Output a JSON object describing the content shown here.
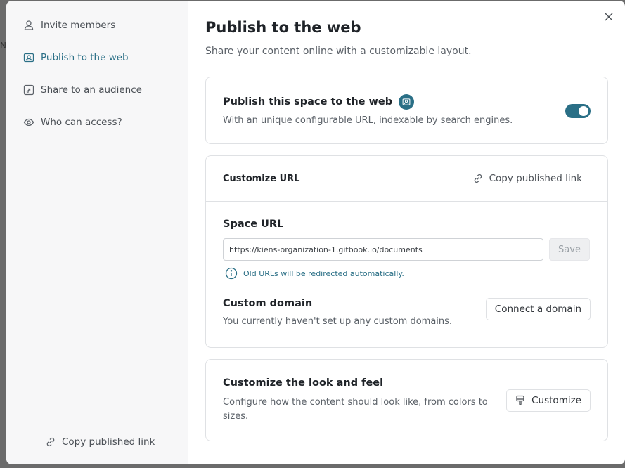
{
  "backdrop_letter": "N",
  "sidebar": {
    "items": [
      {
        "label": "Invite members",
        "icon": "user-icon",
        "active": false
      },
      {
        "label": "Publish to the web",
        "icon": "globe-card-icon",
        "active": true
      },
      {
        "label": "Share to an audience",
        "icon": "share-icon",
        "active": false
      },
      {
        "label": "Who can access?",
        "icon": "eye-icon",
        "active": false
      }
    ],
    "footer_link": "Copy published link"
  },
  "main": {
    "title": "Publish to the web",
    "subtitle": "Share your content online with a customizable layout.",
    "publish_card": {
      "title": "Publish this space to the web",
      "description": "With an unique configurable URL, indexable by search engines.",
      "toggle_on": true
    },
    "url_card": {
      "header_label": "Customize URL",
      "copy_link_label": "Copy published link",
      "space_url_title": "Space URL",
      "space_url_value": "https://kiens-organization-1.gitbook.io/documents",
      "save_label": "Save",
      "hint": "Old URLs will be redirected automatically.",
      "custom_domain_title": "Custom domain",
      "custom_domain_desc": "You currently haven't set up any custom domains.",
      "connect_domain_label": "Connect a domain"
    },
    "look_card": {
      "title": "Customize the look and feel",
      "description": "Configure how the content should look like, from colors to sizes.",
      "customize_label": "Customize"
    }
  },
  "colors": {
    "accent": "#2a6f86",
    "sidebar_bg": "#f7f7f8",
    "border": "#dfe1e4"
  }
}
